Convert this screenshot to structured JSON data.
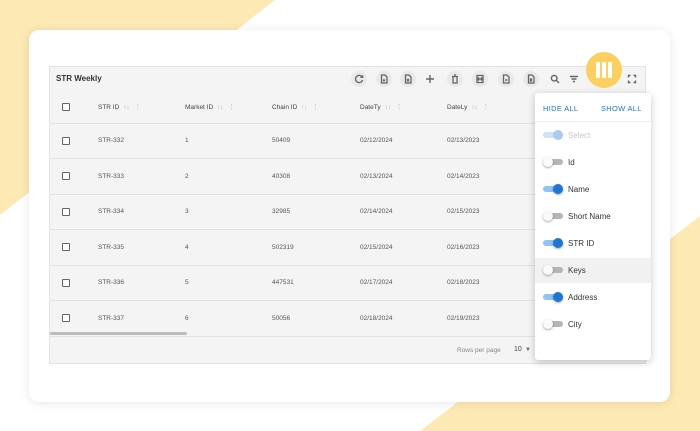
{
  "table": {
    "title": "STR Weekly",
    "columns": [
      "STR ID",
      "Market ID",
      "Chain ID",
      "DateTy",
      "DateLy"
    ],
    "rows": [
      {
        "str_id": "STR-332",
        "market_id": "1",
        "chain_id": "50409",
        "date_ty": "02/12/2024",
        "date_ly": "02/13/2023"
      },
      {
        "str_id": "STR-333",
        "market_id": "2",
        "chain_id": "40308",
        "date_ty": "02/13/2024",
        "date_ly": "02/14/2023"
      },
      {
        "str_id": "STR-334",
        "market_id": "3",
        "chain_id": "32985",
        "date_ty": "02/14/2024",
        "date_ly": "02/15/2023"
      },
      {
        "str_id": "STR-335",
        "market_id": "4",
        "chain_id": "502319",
        "date_ty": "02/15/2024",
        "date_ly": "02/16/2023"
      },
      {
        "str_id": "STR-336",
        "market_id": "5",
        "chain_id": "447531",
        "date_ty": "02/17/2024",
        "date_ly": "02/18/2023"
      },
      {
        "str_id": "STR-337",
        "market_id": "6",
        "chain_id": "50056",
        "date_ty": "02/18/2024",
        "date_ly": "02/19/2023"
      }
    ]
  },
  "footer": {
    "rows_per_page_label": "Rows per page",
    "rows_per_page_value": "10"
  },
  "columns_menu": {
    "hide_all": "HIDE ALL",
    "show_all": "SHOW ALL",
    "items": [
      {
        "label": "Select",
        "state": "disabled"
      },
      {
        "label": "Id",
        "state": "off"
      },
      {
        "label": "Name",
        "state": "on"
      },
      {
        "label": "Short Name",
        "state": "off"
      },
      {
        "label": "STR ID",
        "state": "on"
      },
      {
        "label": "Keys",
        "state": "off"
      },
      {
        "label": "Address",
        "state": "on"
      },
      {
        "label": "City",
        "state": "off"
      }
    ]
  },
  "colors": {
    "accent": "#1e76d2",
    "highlight_button": "#fbd060",
    "background_shape": "#fde9b3"
  },
  "icons": [
    "refresh-icon",
    "export-pdf-icon",
    "export-excel-icon",
    "add-icon",
    "delete-icon",
    "fit-columns-icon",
    "export-csv-icon",
    "export-file-icon",
    "search-icon",
    "filter-icon",
    "columns-icon",
    "fullscreen-icon"
  ]
}
